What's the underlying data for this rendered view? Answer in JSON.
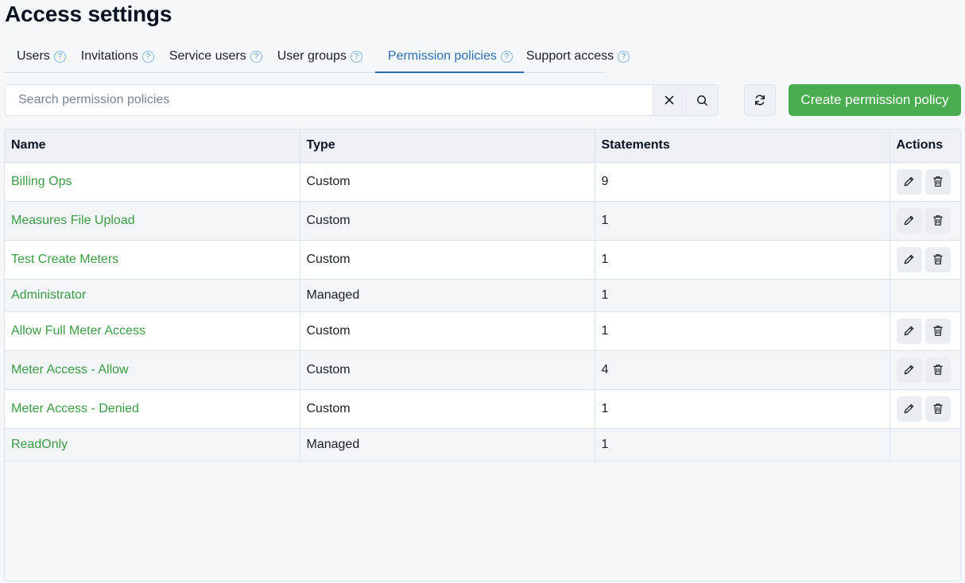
{
  "page": {
    "title": "Access settings"
  },
  "tabs": [
    {
      "label": "Users"
    },
    {
      "label": "Invitations"
    },
    {
      "label": "Service users"
    },
    {
      "label": "User groups"
    },
    {
      "label": "Permission policies",
      "active": true
    },
    {
      "label": "Support access"
    }
  ],
  "help_glyph": "?",
  "search": {
    "placeholder": "Search permission policies",
    "value": ""
  },
  "buttons": {
    "create_label": "Create permission policy"
  },
  "colors": {
    "accent": "#2b6cb0",
    "create_button": "#49ad4f",
    "link": "#3a9b43"
  },
  "table": {
    "headers": {
      "name": "Name",
      "type": "Type",
      "statements": "Statements",
      "actions": "Actions"
    },
    "rows": [
      {
        "name": "Billing Ops",
        "type": "Custom",
        "statements": "9",
        "editable": true
      },
      {
        "name": "Measures File Upload",
        "type": "Custom",
        "statements": "1",
        "editable": true
      },
      {
        "name": "Test Create Meters",
        "type": "Custom",
        "statements": "1",
        "editable": true
      },
      {
        "name": "Administrator",
        "type": "Managed",
        "statements": "1",
        "editable": false
      },
      {
        "name": "Allow Full Meter Access",
        "type": "Custom",
        "statements": "1",
        "editable": true
      },
      {
        "name": "Meter Access - Allow",
        "type": "Custom",
        "statements": "4",
        "editable": true
      },
      {
        "name": "Meter Access - Denied",
        "type": "Custom",
        "statements": "1",
        "editable": true
      },
      {
        "name": "ReadOnly",
        "type": "Managed",
        "statements": "1",
        "editable": false
      }
    ]
  },
  "icons": {
    "clear": "close-icon",
    "search": "search-icon",
    "refresh": "refresh-icon",
    "edit": "pencil-icon",
    "delete": "trash-icon",
    "help": "help-icon"
  }
}
